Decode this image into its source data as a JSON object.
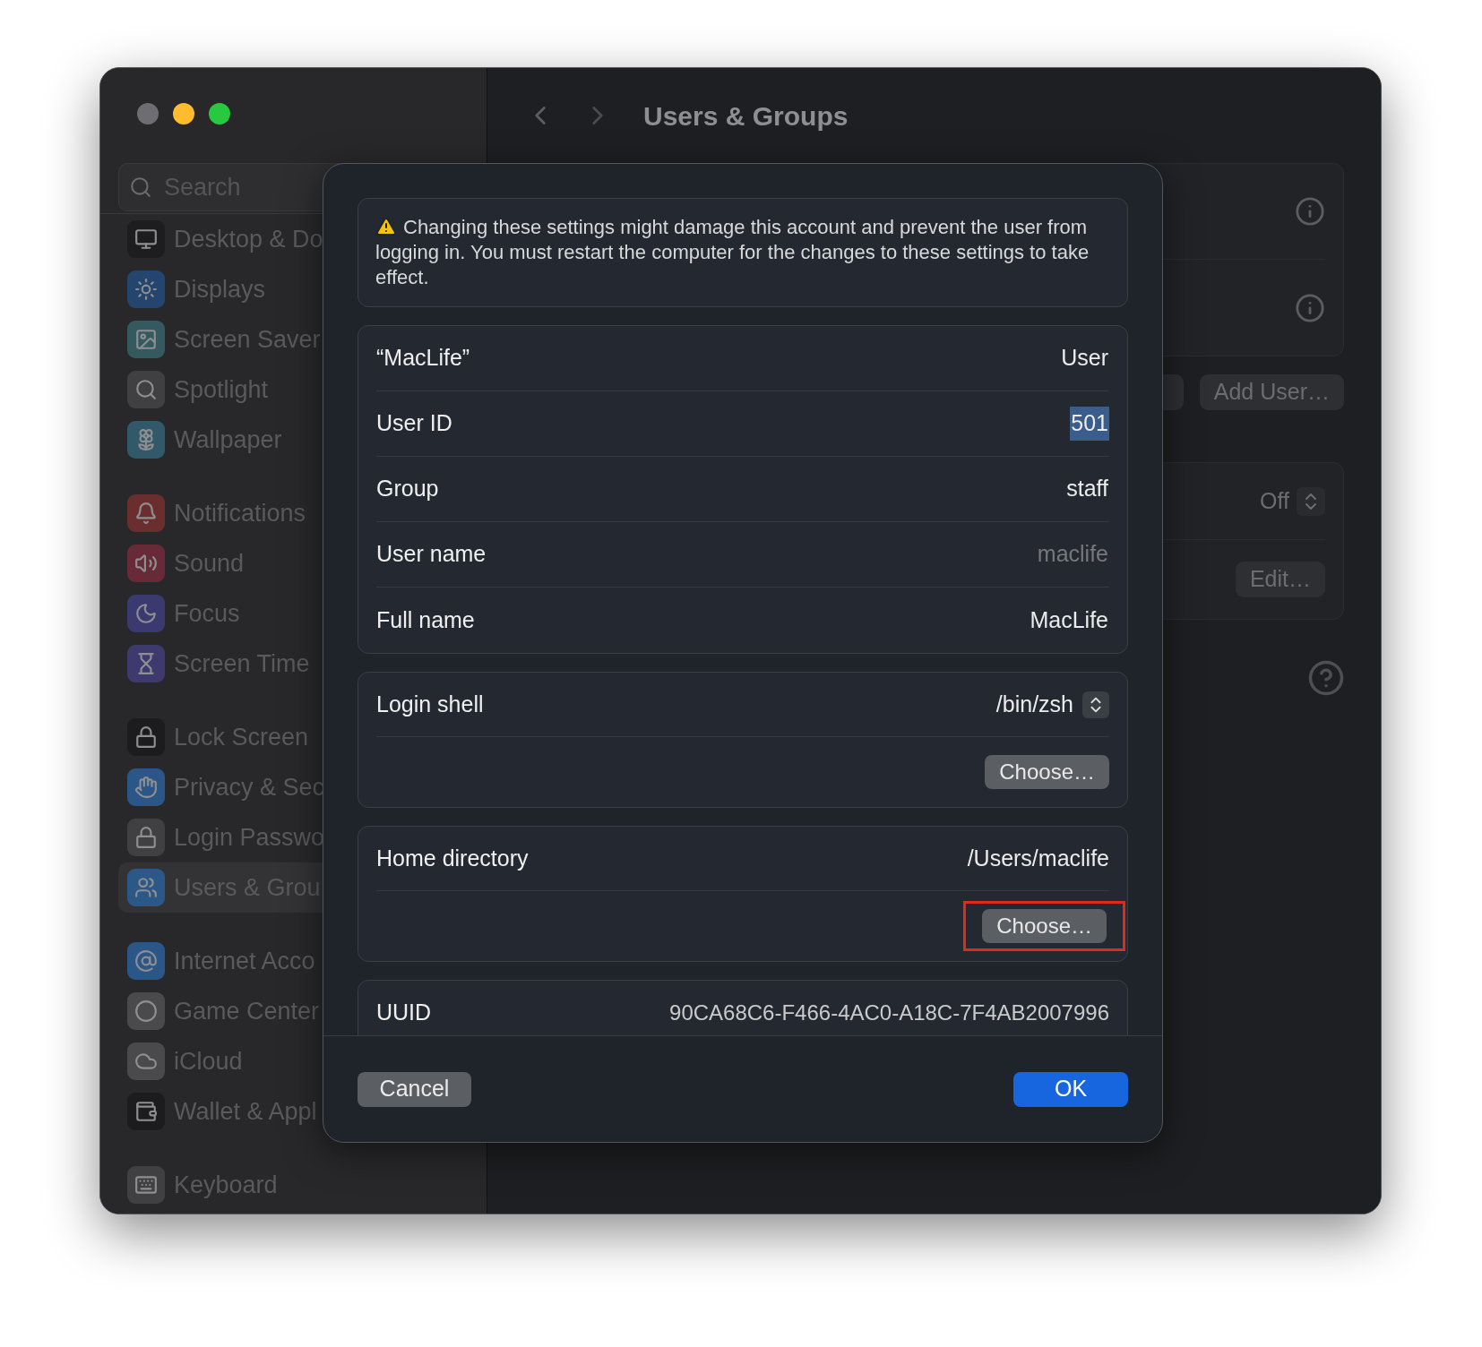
{
  "window": {
    "title": "Users & Groups"
  },
  "sidebar": {
    "search": {
      "placeholder": "Search"
    },
    "groups": [
      [
        {
          "label": "Desktop & Do",
          "color": "#1d1d1f",
          "selected": false
        },
        {
          "label": "Displays",
          "color": "#24456e",
          "selected": false
        },
        {
          "label": "Screen Saver",
          "color": "#34595f",
          "selected": false
        },
        {
          "label": "Spotlight",
          "color": "#404042",
          "selected": false
        },
        {
          "label": "Wallpaper",
          "color": "#32596a",
          "selected": false
        }
      ],
      [
        {
          "label": "Notifications",
          "color": "#6a2e2e",
          "selected": false
        },
        {
          "label": "Sound",
          "color": "#682a36",
          "selected": false
        },
        {
          "label": "Focus",
          "color": "#3b3a70",
          "selected": false
        },
        {
          "label": "Screen Time",
          "color": "#3e3a6e",
          "selected": false
        }
      ],
      [
        {
          "label": "Lock Screen",
          "color": "#1c1c1e",
          "selected": false
        },
        {
          "label": "Privacy & Sec",
          "color": "#2a5688",
          "selected": false
        },
        {
          "label": "Login Passwo",
          "color": "#404042",
          "selected": false
        },
        {
          "label": "Users & Grou",
          "color": "#2c5888",
          "selected": true
        }
      ],
      [
        {
          "label": "Internet Acco",
          "color": "#2a5688",
          "selected": false
        },
        {
          "label": "Game Center",
          "color": "#4a4a4c",
          "selected": false
        },
        {
          "label": "iCloud",
          "color": "#4a4a4c",
          "selected": false
        },
        {
          "label": "Wallet & Appl",
          "color": "#1c1c1e",
          "selected": false
        }
      ],
      [
        {
          "label": "Keyboard",
          "color": "#404042",
          "selected": false
        }
      ]
    ]
  },
  "main": {
    "buttons": [
      "Add User…"
    ],
    "auto_login": {
      "value": "Off"
    },
    "edit_button": "Edit…"
  },
  "dialog": {
    "warning": "Changing these settings might damage this account and prevent the user from logging in. You must restart the computer for the changes to these settings to take effect.",
    "rows": [
      {
        "label": "“MacLife”",
        "value": "User",
        "disabled": false,
        "text_selected": false
      },
      {
        "label": "User ID",
        "value": "501",
        "disabled": false,
        "text_selected": true
      },
      {
        "label": "Group",
        "value": "staff",
        "disabled": false,
        "text_selected": false
      },
      {
        "label": "User name",
        "value": "maclife",
        "disabled": true,
        "text_selected": false
      },
      {
        "label": "Full name",
        "value": "MacLife",
        "disabled": false,
        "text_selected": false
      }
    ],
    "login_shell": {
      "label": "Login shell",
      "value": "/bin/zsh",
      "button": "Choose…",
      "highlighted": false
    },
    "home_directory": {
      "label": "Home directory",
      "value": "/Users/maclife",
      "button": "Choose…",
      "highlighted": true
    },
    "uuid": {
      "label": "UUID",
      "value": "90CA68C6-F466-4AC0-A18C-7F4AB2007996"
    },
    "cancel": "Cancel",
    "ok": "OK"
  }
}
